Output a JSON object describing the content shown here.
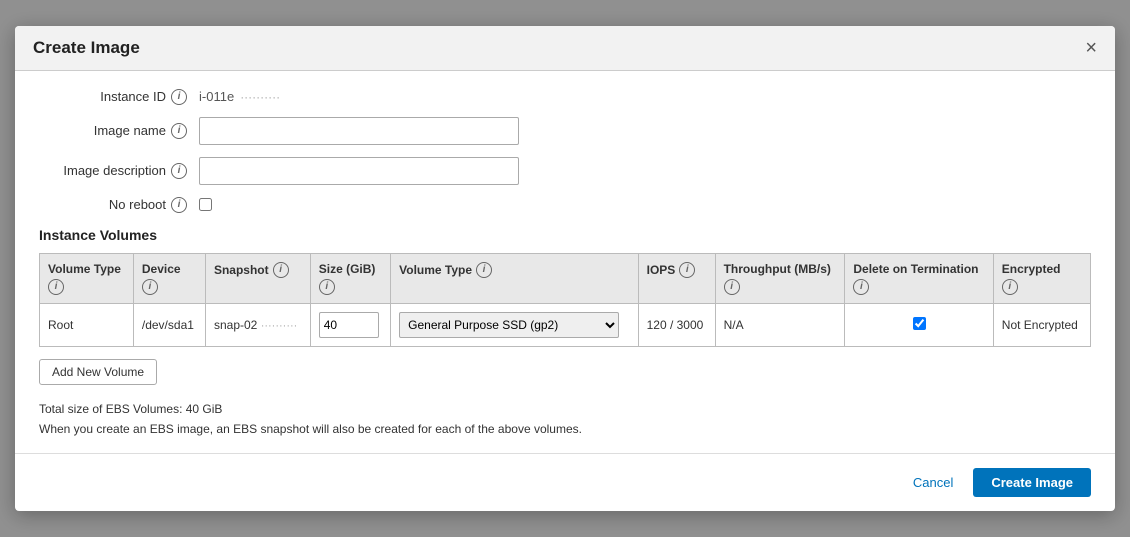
{
  "modal": {
    "title": "Create Image",
    "close_label": "×"
  },
  "form": {
    "instance_id_label": "Instance ID",
    "instance_id_value": "i-011e",
    "instance_id_redacted": "··········",
    "image_name_label": "Image name",
    "image_name_placeholder": "",
    "image_description_label": "Image description",
    "image_description_placeholder": "",
    "no_reboot_label": "No reboot"
  },
  "volumes_section": {
    "title": "Instance Volumes",
    "columns": {
      "volume_type": "Volume Type",
      "device": "Device",
      "snapshot": "Snapshot",
      "size_gib": "Size (GiB)",
      "volume_type_col": "Volume Type",
      "iops": "IOPS",
      "throughput": "Throughput (MB/s)",
      "delete_on_termination": "Delete on Termination",
      "encrypted": "Encrypted"
    },
    "rows": [
      {
        "volume_type": "Root",
        "device": "/dev/sda1",
        "snapshot": "snap-02",
        "snapshot_redacted": "··········",
        "size": "40",
        "volume_type_value": "General Purpose SSD (gp2)",
        "iops": "120 / 3000",
        "throughput": "N/A",
        "delete_on_termination": true,
        "encrypted": "Not Encrypted"
      }
    ],
    "add_volume_label": "Add New Volume"
  },
  "footer_notes": {
    "line1": "Total size of EBS Volumes: 40 GiB",
    "line2": "When you create an EBS image, an EBS snapshot will also be created for each of the above volumes."
  },
  "actions": {
    "cancel_label": "Cancel",
    "create_label": "Create Image"
  },
  "icons": {
    "info": "i",
    "close": "×"
  }
}
